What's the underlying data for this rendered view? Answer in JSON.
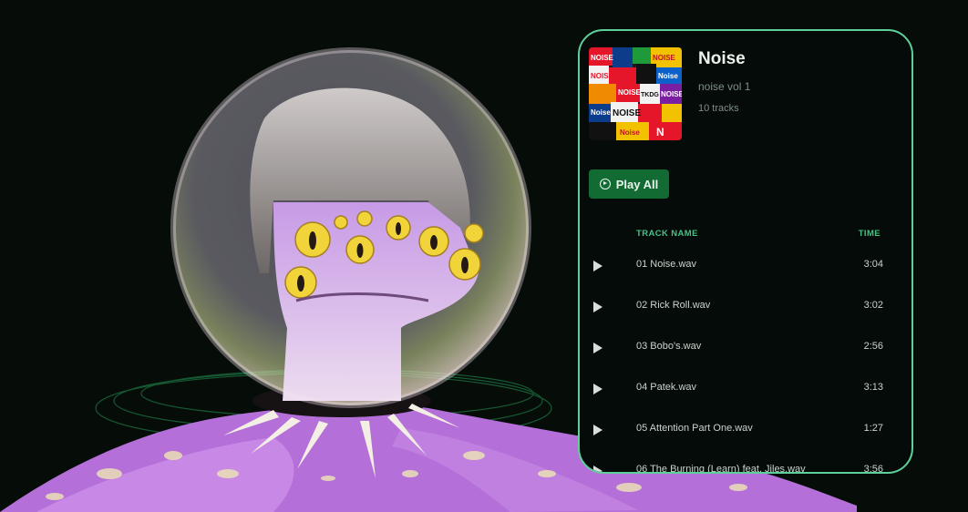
{
  "album": {
    "title": "Noise",
    "subtitle": "noise vol 1",
    "track_count": "10 tracks",
    "cover_text": [
      "NOISE",
      "NOISE",
      "NOISE",
      "Noise",
      "NOISE",
      "TKDG",
      "NOISE",
      "Noise",
      "NOISE",
      "Noise",
      "N"
    ]
  },
  "controls": {
    "play_all_label": "Play All"
  },
  "table": {
    "header_name": "TRACK NAME",
    "header_time": "TIME",
    "tracks": [
      {
        "name": "01 Noise.wav",
        "time": "3:04"
      },
      {
        "name": "02 Rick Roll.wav",
        "time": "3:02"
      },
      {
        "name": "03 Bobo's.wav",
        "time": "2:56"
      },
      {
        "name": "04 Patek.wav",
        "time": "3:13"
      },
      {
        "name": "05 Attention Part One.wav",
        "time": "1:27"
      },
      {
        "name": "06 The Burning (Learn) feat. Jiles.wav",
        "time": "3:56"
      }
    ]
  },
  "colors": {
    "accent": "#5fcf9a",
    "button": "#136b34",
    "background": "#060d09"
  }
}
